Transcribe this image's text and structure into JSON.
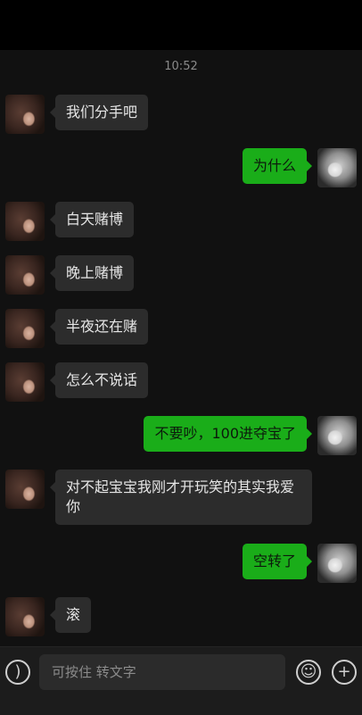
{
  "header": {
    "time": "10:52"
  },
  "messages": [
    {
      "side": "left",
      "text": "我们分手吧"
    },
    {
      "side": "right",
      "text": "为什么"
    },
    {
      "side": "left",
      "text": "白天赌博"
    },
    {
      "side": "left",
      "text": "晚上赌博"
    },
    {
      "side": "left",
      "text": "半夜还在赌"
    },
    {
      "side": "left",
      "text": "怎么不说话"
    },
    {
      "side": "right",
      "text": "不要吵，100进夺宝了"
    },
    {
      "side": "left",
      "text": "对不起宝宝我刚才开玩笑的其实我爱你"
    },
    {
      "side": "right",
      "text": "空转了"
    },
    {
      "side": "left",
      "text": "滚"
    }
  ],
  "input": {
    "hold_to_talk": "可按住 转文字",
    "voice_icon": "voice-icon",
    "emoji_icon": "emoji-icon",
    "plus_icon": "plus-icon"
  },
  "colors": {
    "background": "#111111",
    "incoming_bubble": "#2c2c2c",
    "outgoing_bubble": "#1aad19"
  }
}
